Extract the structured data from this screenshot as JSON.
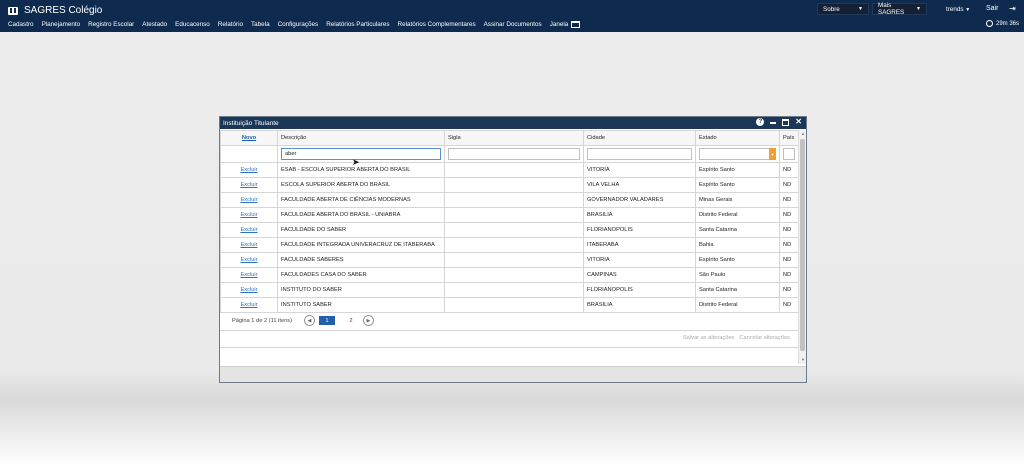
{
  "app": {
    "title": "SAGRES Colégio",
    "colors": {
      "topbar": "#0e2b4f",
      "dialog_title": "#1a3758",
      "link": "#2a73c2",
      "accent": "#f0a033"
    }
  },
  "menu": [
    "Cadastro",
    "Planejamento",
    "Registro Escolar",
    "Atestado",
    "Educacenso",
    "Relatório",
    "Tabela",
    "Configurações",
    "Relatórios Particulares",
    "Relatórios Complementares",
    "Assinar Documentos",
    "Janela"
  ],
  "topright": {
    "sobre": "Sobre",
    "mais": "Mais SAGRES",
    "user": "trends",
    "sair": "Sair",
    "timer": "29m 36s"
  },
  "dialog": {
    "title": "Instituição Titulante",
    "columns": {
      "novo": "Novo",
      "descricao": "Descrição",
      "sigla": "Sigla",
      "cidade": "Cidade",
      "estado": "Estado",
      "pais": "País"
    },
    "filter": {
      "descricao": "aber"
    },
    "action_label": "Excluir",
    "rows": [
      {
        "descricao": "ESAB - ESCOLA SUPERIOR ABERTA DO BRASIL",
        "sigla": "",
        "cidade": "VITORIA",
        "estado": "Espírito Santo",
        "pais": "ND"
      },
      {
        "descricao": "ESCOLA SUPERIOR ABERTA DO BRASIL",
        "sigla": "",
        "cidade": "VILA VELHA",
        "estado": "Espírito Santo",
        "pais": "ND"
      },
      {
        "descricao": "FACULDADE ABERTA DE CIÊNCIAS MODERNAS",
        "sigla": "",
        "cidade": "GOVERNADOR VALADARES",
        "estado": "Minas Gerais",
        "pais": "ND"
      },
      {
        "descricao": "FACULDADE ABERTA DO BRASIL - UNIABRA",
        "sigla": "",
        "cidade": "BRASILIA",
        "estado": "Distrito Federal",
        "pais": "ND"
      },
      {
        "descricao": "FACULDADE DO SABER",
        "sigla": "",
        "cidade": "FLORIANOPOLIS",
        "estado": "Santa Catarina",
        "pais": "ND"
      },
      {
        "descricao": "FACULDADE INTEGRADA UNIVERACRUZ DE ITABERABA",
        "sigla": "",
        "cidade": "ITABERABA",
        "estado": "Bahia",
        "pais": "ND"
      },
      {
        "descricao": "FACULDADE SABERES",
        "sigla": "",
        "cidade": "VITORIA",
        "estado": "Espírito Santo",
        "pais": "ND"
      },
      {
        "descricao": "FACULDADES CASA DO SABER",
        "sigla": "",
        "cidade": "CAMPINAS",
        "estado": "São Paulo",
        "pais": "ND"
      },
      {
        "descricao": "INSTITUTO DO SABER",
        "sigla": "",
        "cidade": "FLORIANOPOLIS",
        "estado": "Santa Catarina",
        "pais": "ND"
      },
      {
        "descricao": "INSTITUTO SABER",
        "sigla": "",
        "cidade": "BRASILIA",
        "estado": "Distrito Federal",
        "pais": "ND"
      }
    ],
    "pager": {
      "info": "Página 1 de 2 (11 itens)",
      "pages": [
        "1",
        "2"
      ],
      "current": "1"
    },
    "footer": {
      "save": "Salvar as alterações",
      "cancel": "Cancelar alterações"
    }
  }
}
